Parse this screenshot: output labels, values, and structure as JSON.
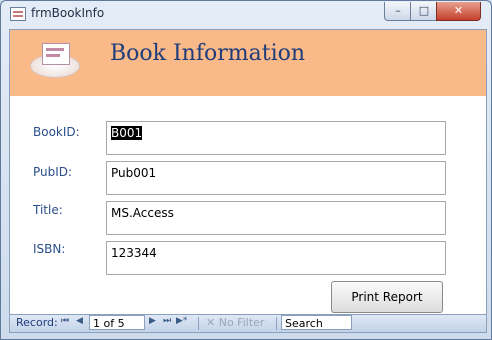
{
  "window": {
    "title": "frmBookInfo",
    "controls": {
      "minimize": "–",
      "maximize": "□",
      "close": "✕"
    }
  },
  "header": {
    "title": "Book Information",
    "icon": "form-icon"
  },
  "fields": [
    {
      "label": "BookID:",
      "value": "B001",
      "selected": true
    },
    {
      "label": "PubID:",
      "value": "Pub001"
    },
    {
      "label": "Title:",
      "value": "MS.Access"
    },
    {
      "label": "ISBN:",
      "value": "123344"
    }
  ],
  "buttons": {
    "print_report": "Print Report"
  },
  "navbar": {
    "record_label": "Record:",
    "first": "⏮",
    "prev": "◀",
    "record_position": "1 of 5",
    "next": "▶",
    "last": "⏭",
    "new": "▶*",
    "filter_label": "No Filter",
    "search_placeholder": "Search"
  },
  "colors": {
    "header_bg": "#f9b988",
    "title_color": "#1f3d7a",
    "label_color": "#2a4f8a"
  }
}
